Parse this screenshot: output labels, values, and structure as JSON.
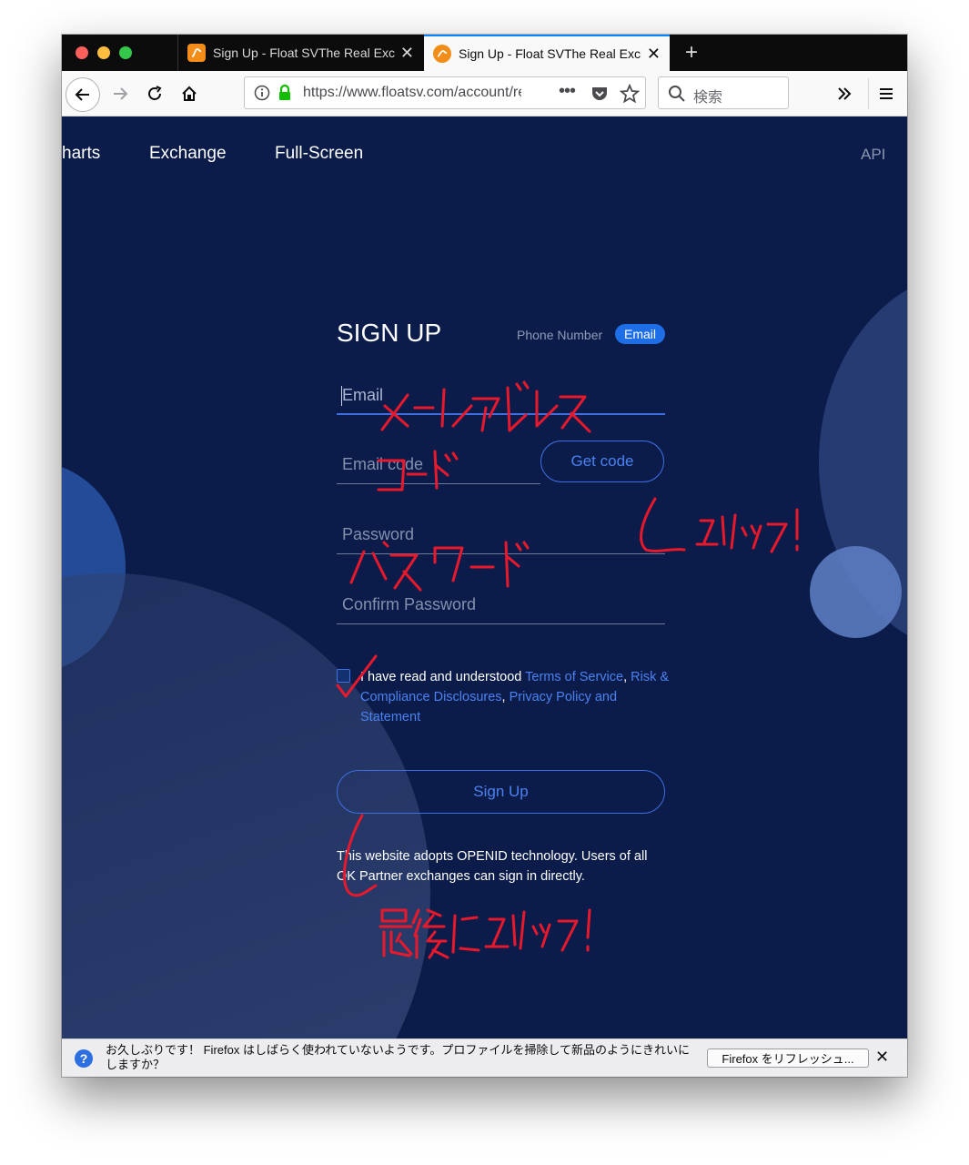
{
  "browser": {
    "tabs": [
      {
        "title": "Sign Up - Float SVThe Real Exchange",
        "active": false
      },
      {
        "title": "Sign Up - Float SVThe Real Exchange",
        "active": true
      }
    ],
    "new_tab_label": "+",
    "url": "https://www.floatsv.com/account/register",
    "search_placeholder": "検索"
  },
  "site_nav": {
    "items": [
      "harts",
      "Exchange",
      "Full-Screen"
    ],
    "api_label": "API"
  },
  "form": {
    "title": "SIGN UP",
    "toggle_phone": "Phone Number",
    "toggle_email": "Email",
    "email_placeholder": "Email",
    "email_code_placeholder": "Email code",
    "get_code_label": "Get code",
    "password_placeholder": "Password",
    "confirm_password_placeholder": "Confirm Password",
    "terms_prefix": "I have read and understood ",
    "terms_link1": "Terms of Service",
    "terms_sep1": ",  ",
    "terms_link2": "Risk & Compliance Disclosures",
    "terms_sep2": ",  ",
    "terms_link3": "Privacy Policy and Statement",
    "signup_label": "Sign Up",
    "openid_text": "This website adopts OPENID technology. Users of all OK Partner exchanges can sign in directly."
  },
  "notification": {
    "text": "お久しぶりです！ Firefox はしばらく使われていないようです。プロファイルを掃除して新品のようにきれいにしますか？",
    "button_label": "Firefox をリフレッシュ...",
    "close_label": "✕"
  },
  "colors": {
    "page_bg": "#0b1c4a",
    "accent": "#3f6fe0",
    "annotation": "#e8192c"
  }
}
